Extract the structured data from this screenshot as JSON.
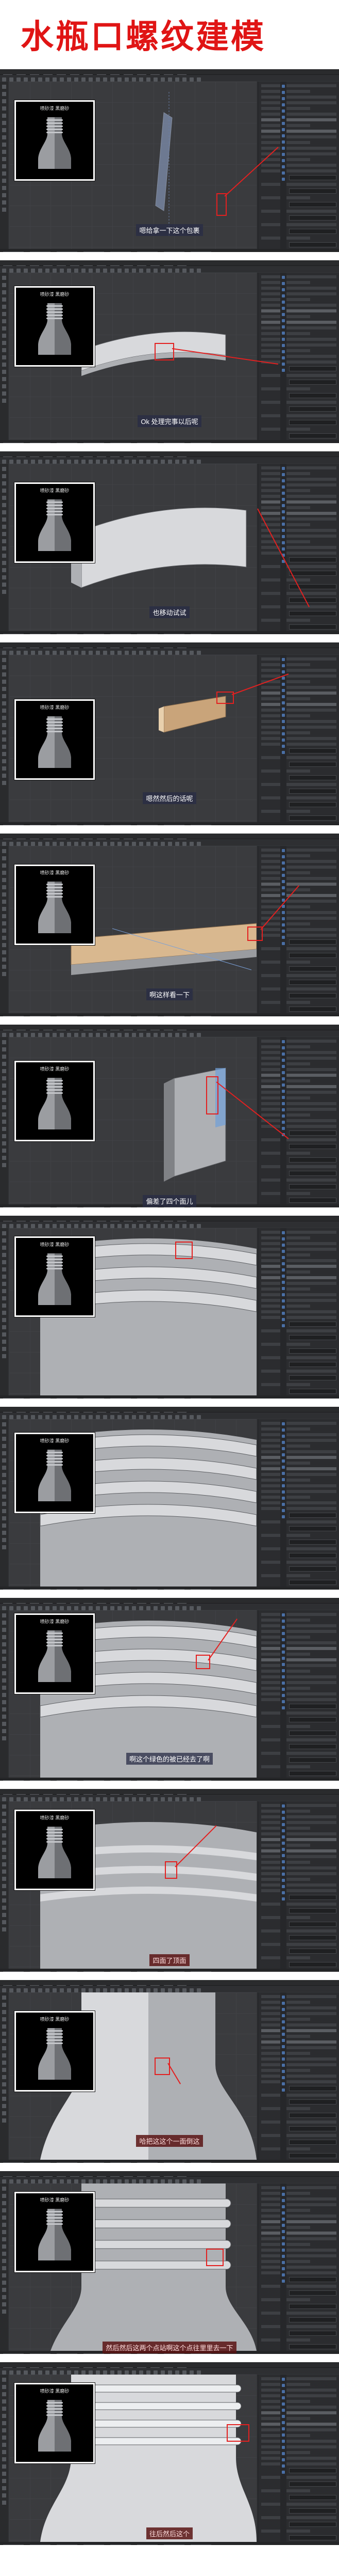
{
  "page": {
    "title": "水瓶口螺纹建模"
  },
  "colors": {
    "title": "#e01515",
    "annotation": "#e32020",
    "app_bg": "#333538",
    "viewport_bg": "#3a3b3e"
  },
  "reference_label": "喷砂漆 黑磨砂",
  "steps": [
    {
      "caption": "嗯给拿一下这个包裹"
    },
    {
      "caption": "Ok 处理完事以后呢"
    },
    {
      "caption": "也移动试试"
    },
    {
      "caption": "嗯然然后的话呢"
    },
    {
      "caption": "啊这样看一下"
    },
    {
      "caption": "偏差了四个面儿"
    },
    {
      "caption": ""
    },
    {
      "caption": ""
    },
    {
      "caption": "啊这个绿色的被已经去了啊"
    },
    {
      "caption": "四面了顶面"
    },
    {
      "caption": "哈把这这个一面倒这"
    },
    {
      "caption": "然后然后这两个点站啊这个点往里里去一下"
    },
    {
      "caption": "往后然后这个"
    }
  ],
  "icons": {
    "app_menu": "menu-bar-icon",
    "toolbar": "toolbar-icon",
    "side_tools": "tool-icon",
    "object_manager": "layer-icon"
  }
}
